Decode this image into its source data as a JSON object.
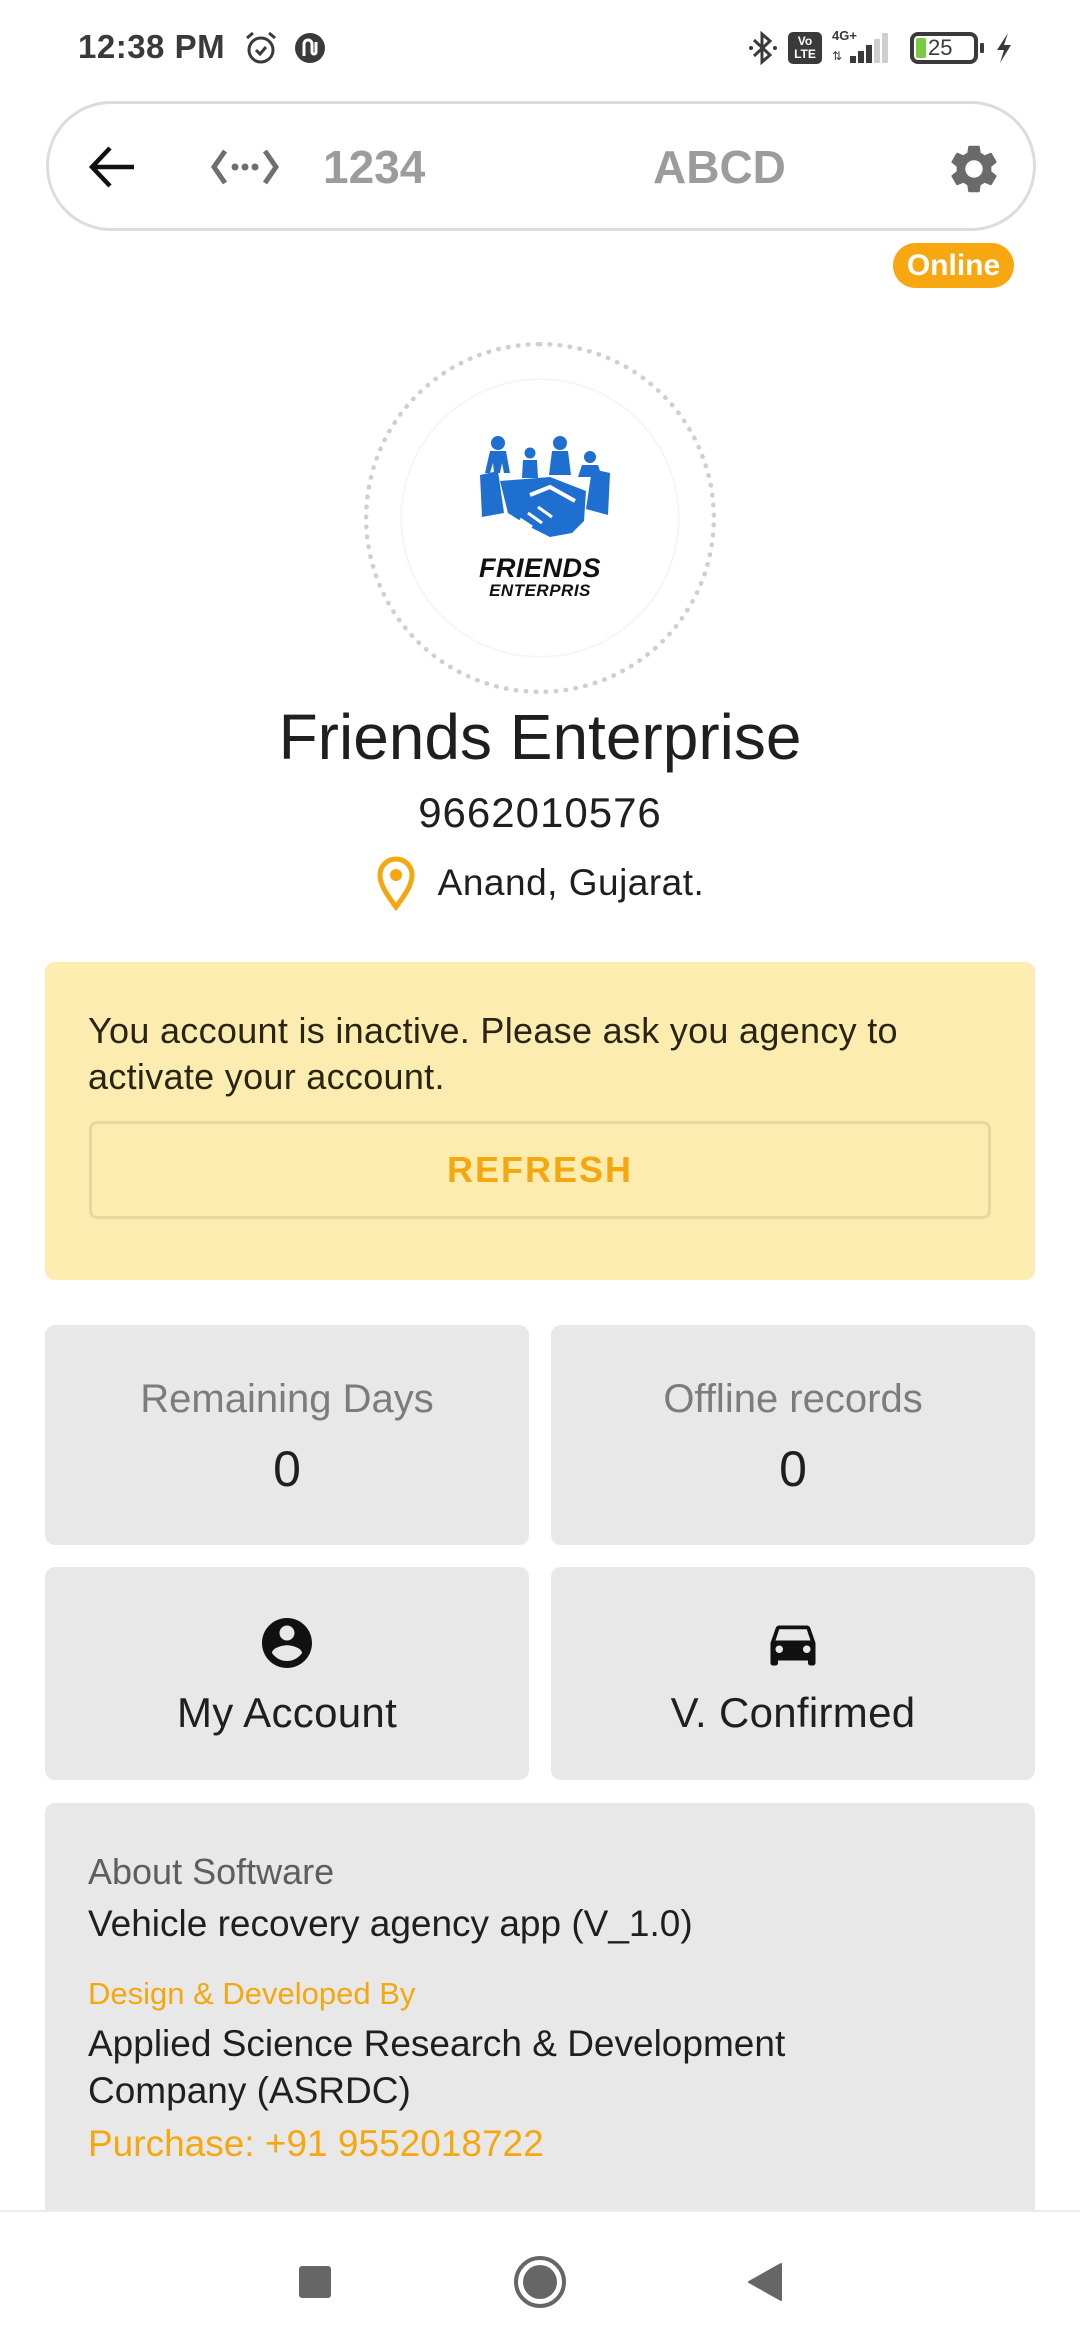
{
  "status_bar": {
    "time": "12:38 PM",
    "left_icons": [
      "alarm-icon",
      "sync-notification-icon"
    ],
    "right_icons": [
      "bluetooth-icon",
      "volte-icon",
      "signal-4g-icon",
      "battery-icon",
      "charging-icon"
    ],
    "volte_line1": "Vo",
    "volte_line2": "LTE",
    "network_type": "4G+",
    "battery_level": "25",
    "battery_color": "#7ac943"
  },
  "top_bar": {
    "back_icon": "arrow-left-icon",
    "code_icon": "code-dots-icon",
    "id_text": "1234",
    "name_text": "ABCD",
    "settings_icon": "gear-icon"
  },
  "status_badge": {
    "label": "Online",
    "color": "#f7a70f"
  },
  "logo": {
    "line1": "FRIENDS",
    "line2": "ENTERPRIS",
    "brand_color": "#1f6fd0"
  },
  "profile": {
    "business_name": "Friends Enterprise",
    "phone": "9662010576",
    "location": "Anand, Gujarat.",
    "location_icon": "map-pin-icon",
    "accent_color": "#f5a70f"
  },
  "alert": {
    "message": "You account is inactive. Please ask you agency to activate your account.",
    "button_label": "REFRESH",
    "background": "#fcecb0"
  },
  "stats": [
    {
      "label": "Remaining Days",
      "value": "0"
    },
    {
      "label": "Offline records",
      "value": "0"
    }
  ],
  "actions": [
    {
      "label": "My Account",
      "icon": "account-circle-icon"
    },
    {
      "label": "V. Confirmed",
      "icon": "car-icon"
    }
  ],
  "about": {
    "heading": "About Software",
    "app_name": "Vehicle recovery agency app (V_1.0)",
    "developed_by_label": "Design & Developed By",
    "company_line1": "Applied Science Research & Development",
    "company_line2": "Company (ASRDC)",
    "purchase": "Purchase: +91 9552018722"
  },
  "nav_bar": {
    "buttons": [
      "recents-square-icon",
      "home-circle-icon",
      "back-triangle-icon"
    ]
  }
}
